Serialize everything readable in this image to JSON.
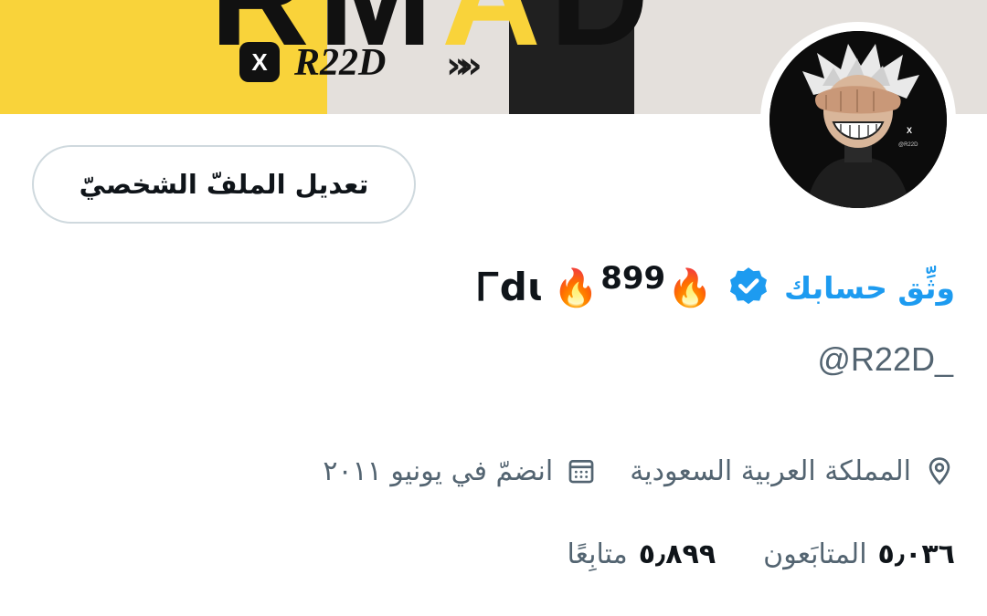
{
  "banner": {
    "big_text_a": "RM",
    "big_text_b": "A",
    "big_text_c": "D",
    "logo_letter": "X",
    "brand": "R22D",
    "arrows": "»",
    "colors": {
      "yellow": "#f9d33a",
      "dark": "#202020",
      "light": "#e4e0dc"
    }
  },
  "avatar": {
    "badge_x": "X",
    "badge_text": "@R22D"
  },
  "profile": {
    "edit_button": "تعديل الملفّ الشخصيّ",
    "verify_link": "وثِّق حسابك",
    "name_fire_1": "🔥",
    "name_number": "899",
    "name_fire_2": "🔥",
    "name_tag": "Ꮁdɩ",
    "handle": "@R22D_",
    "location": "المملكة العربية السعودية",
    "joined": "انضمّ في يونيو ٢٠١١",
    "followers_count": "٥٫٠٣٦",
    "followers_label": "المتابَعون",
    "following_count": "٥٫٨٩٩",
    "following_label": "متابِعًا"
  },
  "icons": {
    "verified": "verified-badge-icon",
    "location": "location-pin-icon",
    "calendar": "calendar-icon"
  },
  "colors": {
    "accent": "#1d9bf0",
    "text": "#0f1419",
    "secondary": "#536471",
    "border": "#cfd9de"
  }
}
